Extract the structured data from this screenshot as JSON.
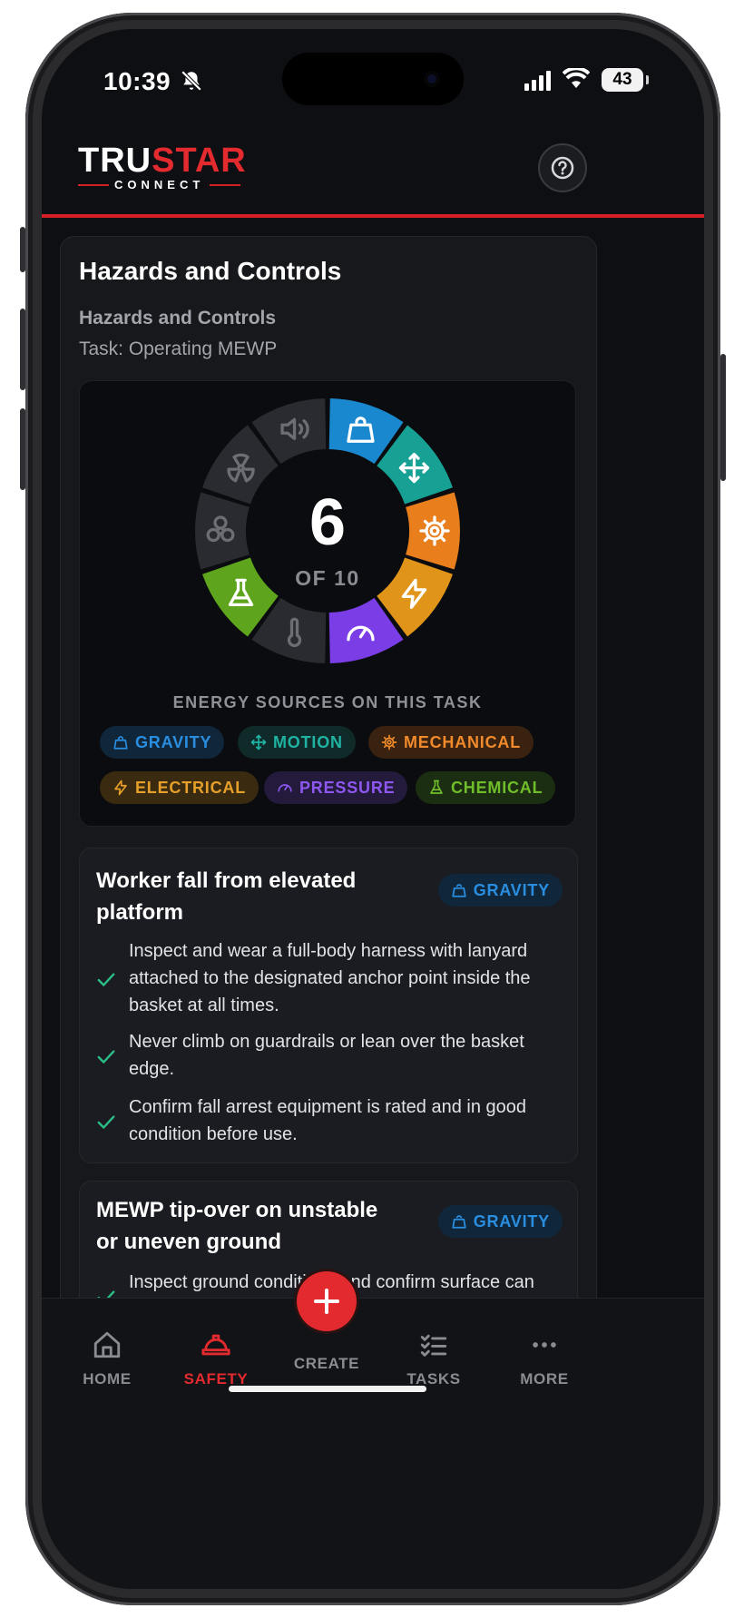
{
  "status_bar": {
    "time": "10:39",
    "battery": "43"
  },
  "header": {
    "logo_main_a": "TRU",
    "logo_main_b": "STAR",
    "logo_sub": "CONNECT",
    "help_icon": "question-circle-icon"
  },
  "card": {
    "title": "Hazards and Controls",
    "subtitle": "Hazards and Controls",
    "task": "Task: Operating MEWP"
  },
  "energy": {
    "count": "6",
    "of_label": "OF 10",
    "caption": "ENERGY SOURCES ON THIS TASK",
    "wheel_segments": [
      {
        "name": "gravity",
        "icon": "weight-icon",
        "active": true,
        "color": "#1a88cf"
      },
      {
        "name": "motion",
        "icon": "move-arrows-icon",
        "active": true,
        "color": "#17a094"
      },
      {
        "name": "mechanical",
        "icon": "gear-icon",
        "active": true,
        "color": "#e87e1c"
      },
      {
        "name": "electrical",
        "icon": "lightning-icon",
        "active": true,
        "color": "#e0941a"
      },
      {
        "name": "pressure",
        "icon": "gauge-icon",
        "active": true,
        "color": "#7b3ee6"
      },
      {
        "name": "temperature",
        "icon": "thermometer-icon",
        "active": false,
        "color": "#2a2b30"
      },
      {
        "name": "chemical",
        "icon": "flask-icon",
        "active": true,
        "color": "#5ea51d"
      },
      {
        "name": "biological",
        "icon": "biohazard-icon",
        "active": false,
        "color": "#2a2b30"
      },
      {
        "name": "radiation",
        "icon": "radiation-icon",
        "active": false,
        "color": "#2a2b30"
      },
      {
        "name": "sound",
        "icon": "speaker-icon",
        "active": false,
        "color": "#2a2b30"
      }
    ],
    "chips": [
      {
        "label": "GRAVITY",
        "icon": "weight-icon",
        "color": "#2a8ee0",
        "bg": "#10263a"
      },
      {
        "label": "MOTION",
        "icon": "move-arrows-icon",
        "color": "#1fb3a3",
        "bg": "#0f2a28"
      },
      {
        "label": "MECHANICAL",
        "icon": "gear-icon",
        "color": "#f08a2a",
        "bg": "#3a2210"
      },
      {
        "label": "ELECTRICAL",
        "icon": "lightning-icon",
        "color": "#e6a02a",
        "bg": "#3a2a10"
      },
      {
        "label": "PRESSURE",
        "icon": "gauge-icon",
        "color": "#8e58f0",
        "bg": "#231a3c"
      },
      {
        "label": "CHEMICAL",
        "icon": "flask-icon",
        "color": "#6fbd2a",
        "bg": "#1c2e12"
      }
    ]
  },
  "hazards": [
    {
      "title": "Worker fall from elevated platform",
      "tag": "GRAVITY",
      "controls": [
        "Inspect and wear a full-body harness with lanyard attached to the designated anchor point inside the basket at all times.",
        "Never climb on guardrails or lean over the basket edge.",
        "Confirm fall arrest equipment is rated and in good condition before use."
      ]
    },
    {
      "title": "MEWP tip-over on unstable or uneven ground",
      "tag": "GRAVITY",
      "controls": [
        "Inspect ground conditions and confirm surface can support the MEWP's rated load before"
      ]
    }
  ],
  "nav": {
    "home": "HOME",
    "safety": "SAFETY",
    "create": "CREATE",
    "tasks": "TASKS",
    "more": "MORE"
  },
  "colors": {
    "accent": "#e32a2f",
    "check": "#2bbf88",
    "background": "#0e0f12"
  }
}
